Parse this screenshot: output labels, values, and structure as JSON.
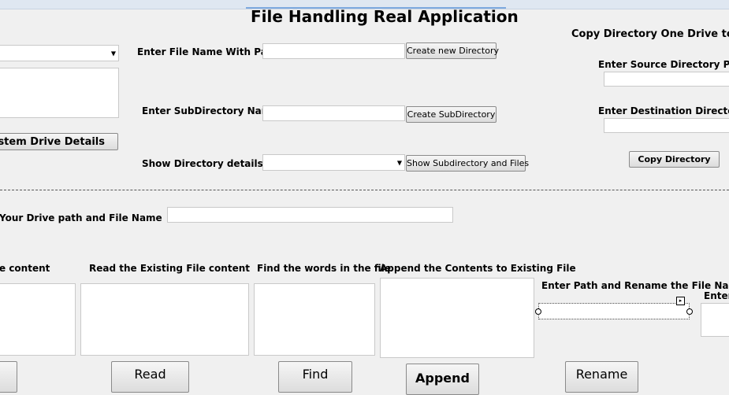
{
  "title": "File Handling Real Application",
  "top_left": {
    "system_drive_button": "stem Drive Details"
  },
  "directory": {
    "file_name_label": "Enter File Name With Path",
    "create_dir_button": "Create new Directory",
    "subdir_label": "Enter SubDirectory Name",
    "create_subdir_button": "Create SubDirectory",
    "show_details_label": "Show Directory details.",
    "show_subdir_button": "Show Subdirectory and Files"
  },
  "copy": {
    "title": "Copy Directory One Drive to",
    "source_label": "Enter Source Directory Path a",
    "destination_label": "Enter Destination Directory Pa",
    "copy_button": "Copy Directory"
  },
  "drive_path": {
    "label": "Your Drive path and File Name"
  },
  "bottom": {
    "content_label": "e content",
    "read_label": "Read the Existing File content",
    "find_label": "Find the words in the file",
    "append_label": "Append the Contents to Existing File",
    "rename_label": "Enter Path and Rename the File Name",
    "enter_label": "Enter",
    "read_button": "Read",
    "find_button": "Find",
    "append_button": "Append",
    "rename_button": "Rename"
  },
  "icons": {
    "combo_arrow": "▼",
    "smart_tag": "▸"
  }
}
